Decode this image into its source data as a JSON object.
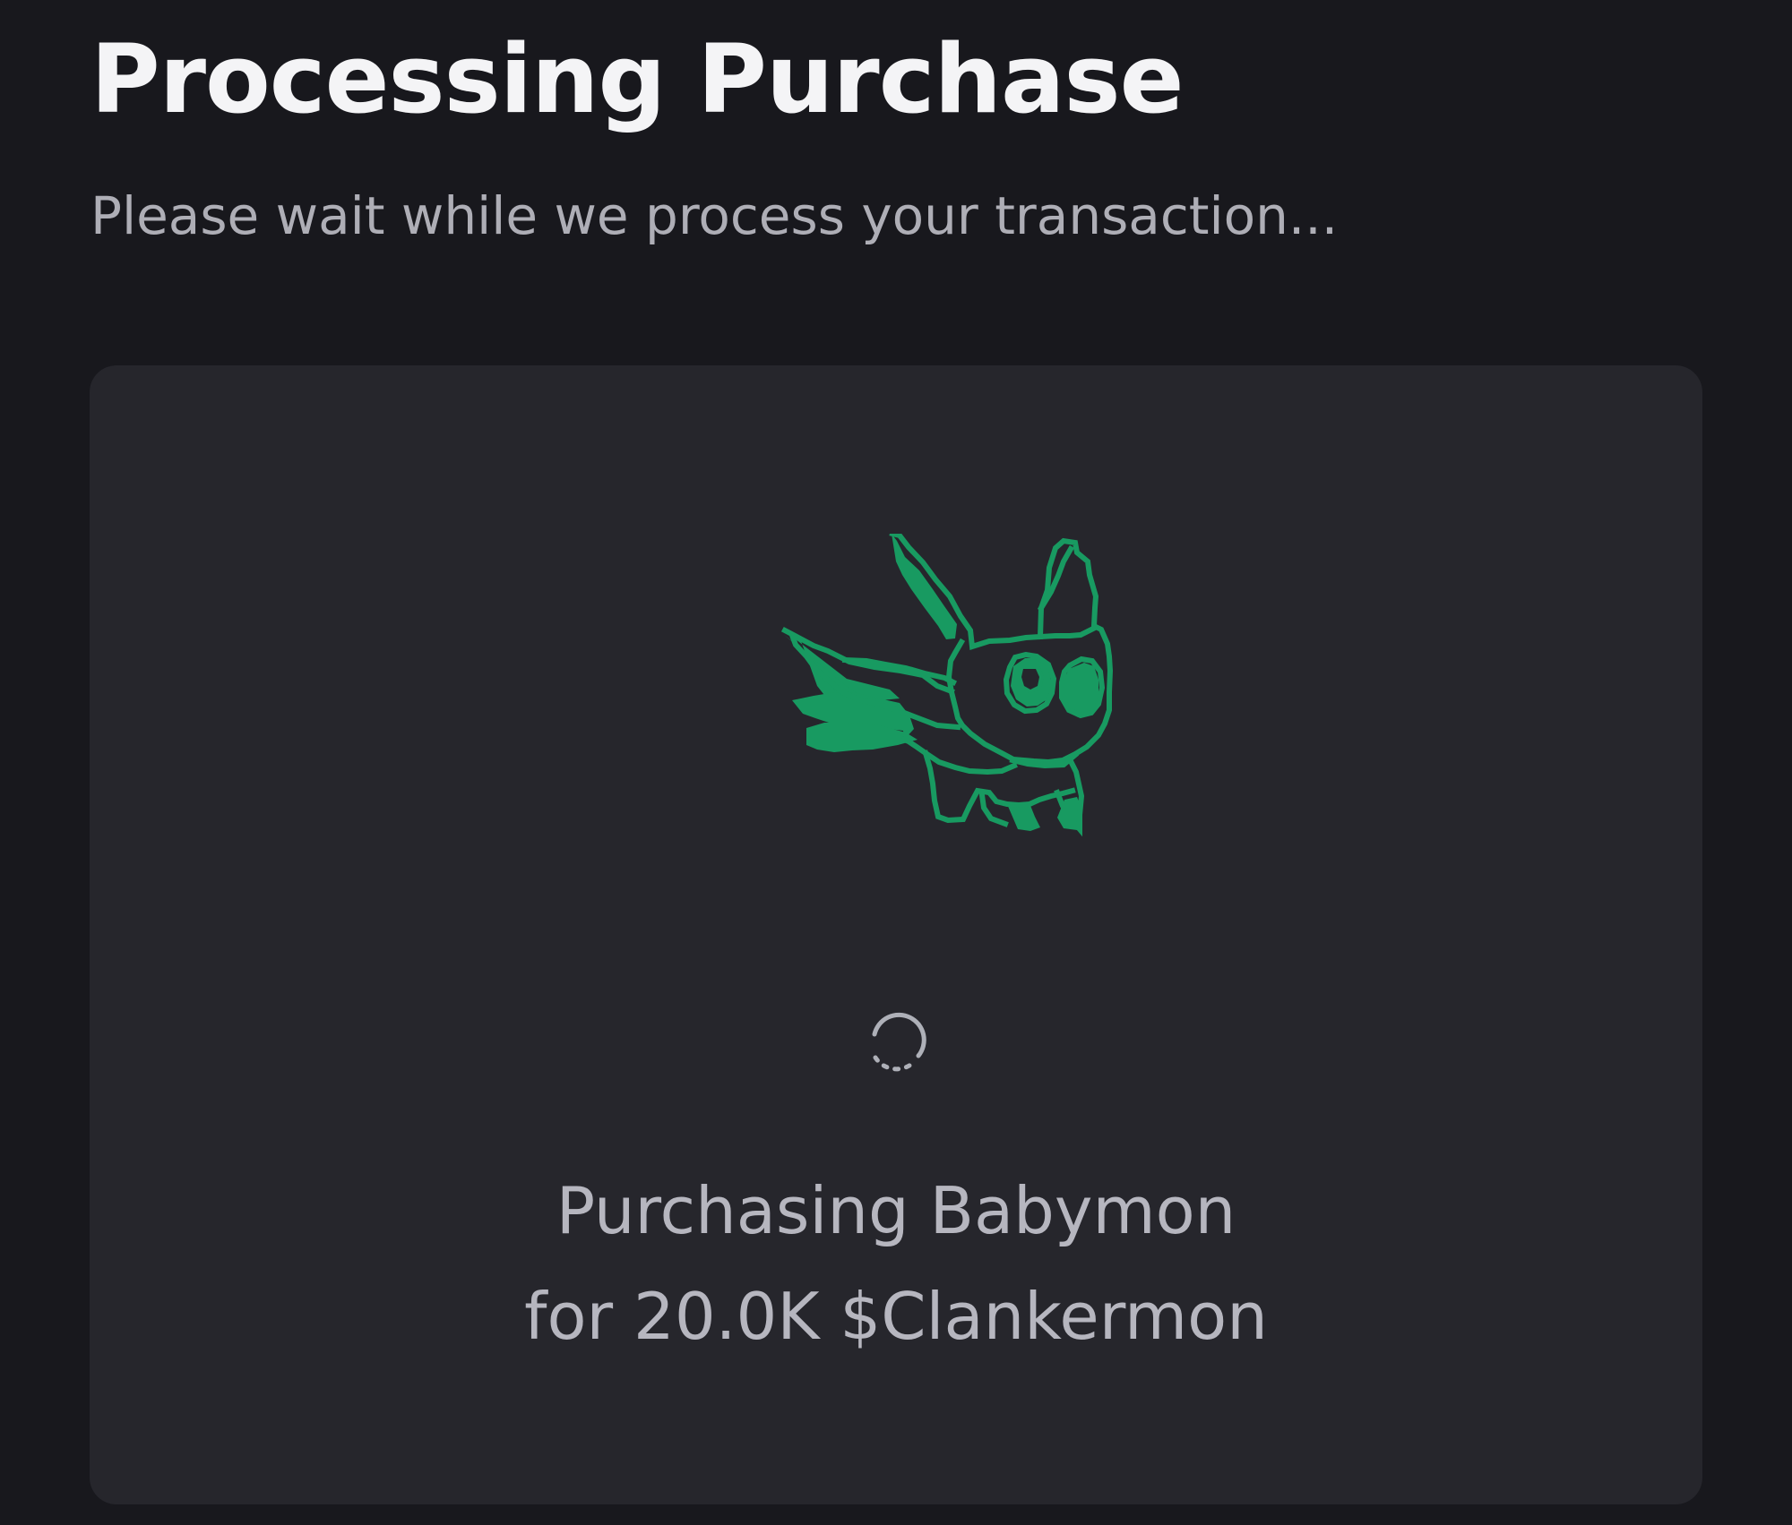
{
  "header": {
    "title": "Processing Purchase",
    "subtitle": "Please wait while we process your transaction..."
  },
  "card": {
    "creature_icon": "babymon-pixel-creature",
    "loading_icon": "loading-spinner-icon",
    "status_line_1": "Purchasing Babymon",
    "status_line_2": "for 20.0K $Clankermon"
  },
  "colors": {
    "background": "#18181d",
    "card": "#26262c",
    "title": "#f4f4f6",
    "subtitle": "#aeaeb6",
    "creature": "#189a61",
    "status_text": "#b6b6bf"
  }
}
